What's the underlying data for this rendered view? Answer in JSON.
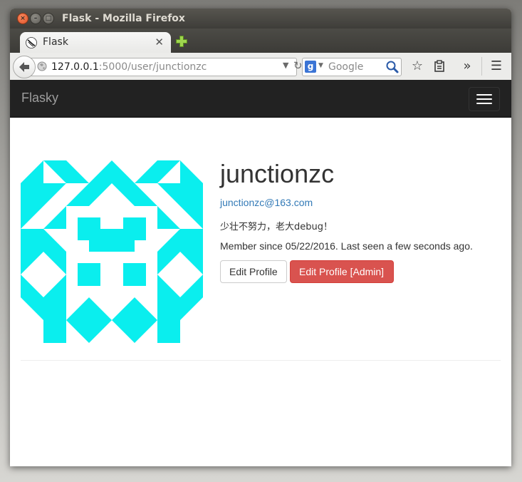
{
  "window": {
    "title": "Flask - Mozilla Firefox"
  },
  "browser": {
    "tab_label": "Flask",
    "url_host": "127.0.0.1",
    "url_rest": ":5000/user/junctionzc",
    "search_placeholder": "Google",
    "search_engine_icon": "google-g-icon"
  },
  "app": {
    "brand": "Flasky"
  },
  "profile": {
    "username": "junctionzc",
    "email": "junctionzc@163.com",
    "about_me": "少壮不努力，老大debug！",
    "member_since": "Member since 05/22/2016. Last seen a few seconds ago.",
    "edit_profile_label": "Edit Profile",
    "edit_profile_admin_label": "Edit Profile [Admin]",
    "avatar_color": "#0aeeee"
  },
  "colors": {
    "navbar_bg": "#222222",
    "link": "#337ab7",
    "danger": "#d9534f"
  }
}
